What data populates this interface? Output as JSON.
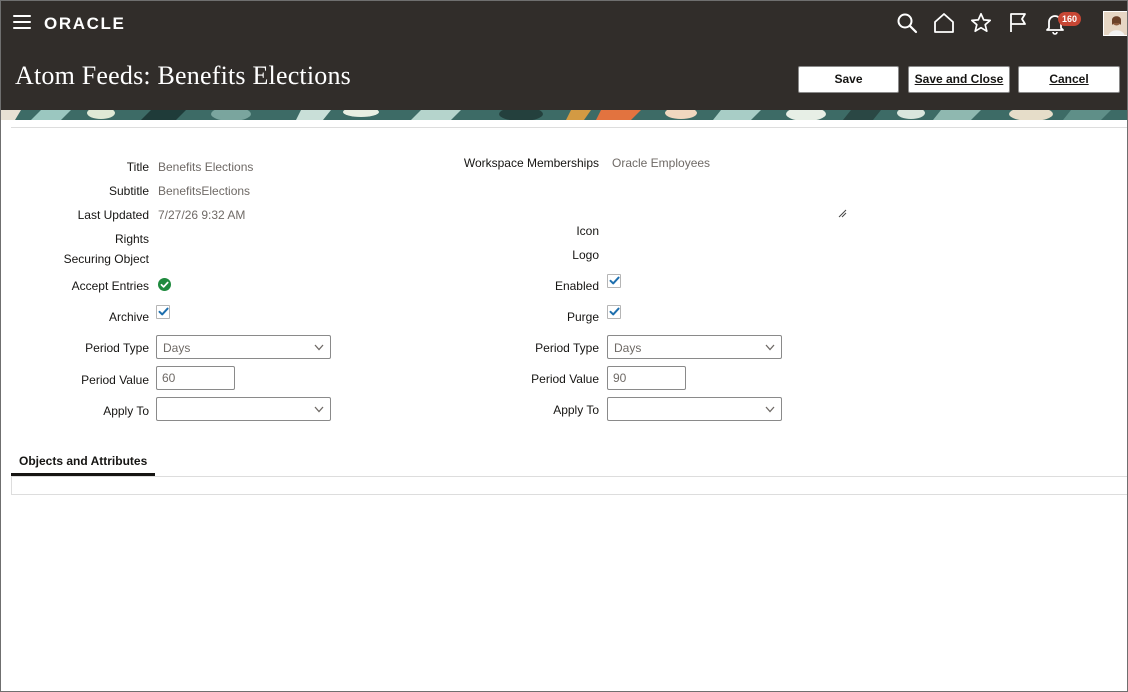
{
  "header": {
    "logo_text": "ORACLE",
    "notification_count": "160",
    "icons": [
      "menu-icon",
      "search-icon",
      "home-icon",
      "star-icon",
      "flag-icon",
      "bell-icon",
      "avatar"
    ]
  },
  "page": {
    "title": "Atom Feeds: Benefits Elections"
  },
  "toolbar": {
    "save_label": "Save",
    "save_close_label": "Save and Close",
    "cancel_label": "Cancel"
  },
  "form": {
    "left": {
      "title_label": "Title",
      "title_value": "Benefits Elections",
      "subtitle_label": "Subtitle",
      "subtitle_value": "BenefitsElections",
      "last_updated_label": "Last Updated",
      "last_updated_value": "7/27/26 9:32 AM",
      "rights_label": "Rights",
      "securing_object_label": "Securing Object",
      "accept_entries_label": "Accept Entries",
      "accept_entries_value": true,
      "archive_label": "Archive",
      "archive_value": true,
      "period_type_label": "Period Type",
      "period_type_value": "Days",
      "period_value_label": "Period Value",
      "period_value_value": "60",
      "apply_to_label": "Apply To",
      "apply_to_value": ""
    },
    "right": {
      "workspace_label": "Workspace Memberships",
      "workspace_value": "Oracle Employees",
      "icon_label": "Icon",
      "logo_label": "Logo",
      "enabled_label": "Enabled",
      "enabled_value": true,
      "purge_label": "Purge",
      "purge_value": true,
      "period_type_label": "Period Type",
      "period_type_value": "Days",
      "period_value_label": "Period Value",
      "period_value_value": "90",
      "apply_to_label": "Apply To",
      "apply_to_value": ""
    }
  },
  "tabs": [
    {
      "label": "Objects and Attributes",
      "selected": true
    }
  ],
  "colors": {
    "header_bg": "#312d2a",
    "success_green": "#1f8a3e",
    "checkbox_blue": "#1e6fae",
    "badge_red": "#c74634"
  }
}
